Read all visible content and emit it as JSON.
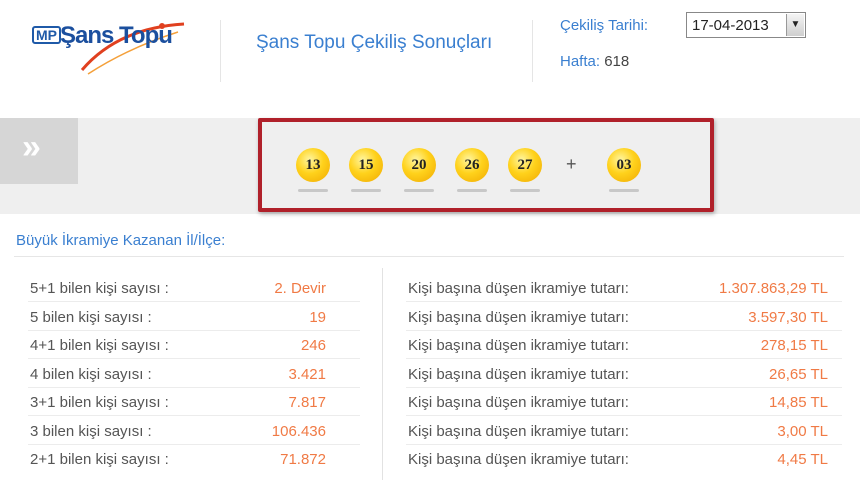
{
  "header": {
    "logo_mp": "MP",
    "logo_name": "Şans Topu",
    "title": "Şans Topu Çekiliş Sonuçları",
    "date_label": "Çekiliş Tarihi:",
    "date_value": "17-04-2013",
    "week_label": "Hafta:",
    "week_value": "618"
  },
  "draw": {
    "balls": [
      "13",
      "15",
      "20",
      "26",
      "27"
    ],
    "plus": "+",
    "bonus": "03"
  },
  "section_title": "Büyük İkramiye Kazanan İl/İlçe:",
  "results": [
    {
      "label": "5+1 bilen kişi sayısı :",
      "count": "2. Devir",
      "prize_label": "Kişi başına düşen ikramiye tutarı:",
      "prize": "1.307.863,29 TL"
    },
    {
      "label": "5 bilen kişi sayısı :",
      "count": "19",
      "prize_label": "Kişi başına düşen ikramiye tutarı:",
      "prize": "3.597,30 TL"
    },
    {
      "label": "4+1 bilen kişi sayısı :",
      "count": "246",
      "prize_label": "Kişi başına düşen ikramiye tutarı:",
      "prize": "278,15 TL"
    },
    {
      "label": "4 bilen kişi sayısı :",
      "count": "3.421",
      "prize_label": "Kişi başına düşen ikramiye tutarı:",
      "prize": "26,65 TL"
    },
    {
      "label": "3+1 bilen kişi sayısı :",
      "count": "7.817",
      "prize_label": "Kişi başına düşen ikramiye tutarı:",
      "prize": "14,85 TL"
    },
    {
      "label": "3 bilen kişi sayısı :",
      "count": "106.436",
      "prize_label": "Kişi başına düşen ikramiye tutarı:",
      "prize": "3,00 TL"
    },
    {
      "label": "2+1 bilen kişi sayısı :",
      "count": "71.872",
      "prize_label": "Kişi başına düşen ikramiye tutarı:",
      "prize": "4,45 TL"
    }
  ]
}
